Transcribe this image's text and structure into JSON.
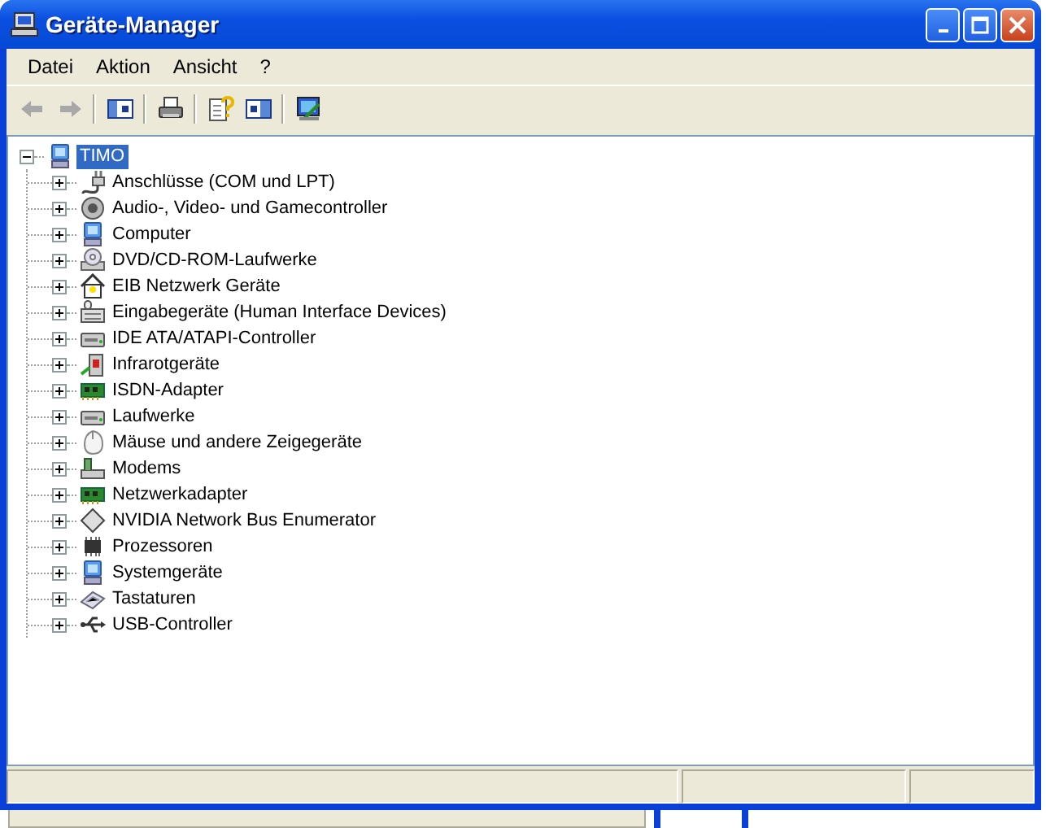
{
  "window": {
    "title": "Geräte-Manager"
  },
  "menu": [
    {
      "label": "Datei"
    },
    {
      "label": "Aktion"
    },
    {
      "label": "Ansicht"
    },
    {
      "label": "?"
    }
  ],
  "toolbar": {
    "back_disabled": true,
    "forward_disabled": true
  },
  "tree": {
    "label": "TIMO",
    "selected": true,
    "expanded": true,
    "children": [
      {
        "label": "Anschlüsse (COM und LPT)",
        "selected": false,
        "expanded": false
      },
      {
        "label": "Audio-, Video- und Gamecontroller",
        "selected": false,
        "expanded": false
      },
      {
        "label": "Computer",
        "selected": false,
        "expanded": false
      },
      {
        "label": "DVD/CD-ROM-Laufwerke",
        "selected": false,
        "expanded": false
      },
      {
        "label": "EIB Netzwerk Geräte",
        "selected": false,
        "expanded": false
      },
      {
        "label": "Eingabegeräte (Human Interface Devices)",
        "selected": false,
        "expanded": false
      },
      {
        "label": "IDE ATA/ATAPI-Controller",
        "selected": false,
        "expanded": false
      },
      {
        "label": "Infrarotgeräte",
        "selected": false,
        "expanded": false
      },
      {
        "label": "ISDN-Adapter",
        "selected": false,
        "expanded": false
      },
      {
        "label": "Laufwerke",
        "selected": false,
        "expanded": false
      },
      {
        "label": "Mäuse und andere Zeigegeräte",
        "selected": false,
        "expanded": false
      },
      {
        "label": "Modems",
        "selected": false,
        "expanded": false
      },
      {
        "label": "Netzwerkadapter",
        "selected": false,
        "expanded": false
      },
      {
        "label": "NVIDIA Network Bus Enumerator",
        "selected": false,
        "expanded": false
      },
      {
        "label": "Prozessoren",
        "selected": false,
        "expanded": false
      },
      {
        "label": "Systemgeräte",
        "selected": false,
        "expanded": false
      },
      {
        "label": "Tastaturen",
        "selected": false,
        "expanded": false
      },
      {
        "label": "USB-Controller",
        "selected": false,
        "expanded": false
      }
    ]
  }
}
